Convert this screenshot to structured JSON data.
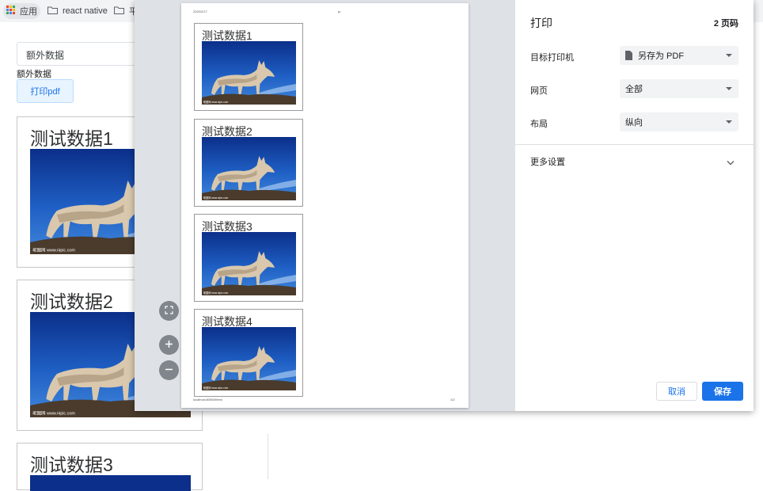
{
  "bookmarks": {
    "apps_label": "应用",
    "items": [
      "react native",
      "平"
    ]
  },
  "page": {
    "extra_input_value": "额外数据",
    "extra_label": "额外数据",
    "print_button": "打印pdf",
    "cards": [
      "测试数据1",
      "测试数据2",
      "测试数据3"
    ]
  },
  "preview": {
    "header_date": "2020/2/17",
    "header_title": "pr",
    "cards": [
      "测试数据1",
      "测试数据2",
      "测试数据3",
      "测试数据4"
    ],
    "footer_url": "localhost:8080/#/test",
    "footer_page": "1/2",
    "image_watermark": "昵图网 www.nipic.com"
  },
  "settings": {
    "title": "打印",
    "page_count": "2 页码",
    "destination_label": "目标打印机",
    "destination_value": "另存为 PDF",
    "pages_label": "网页",
    "pages_value": "全部",
    "layout_label": "布局",
    "layout_value": "纵向",
    "more_settings": "更多设置",
    "cancel": "取消",
    "save": "保存"
  },
  "colors": {
    "accent": "#1a73e8",
    "preview_bg": "#dee1e6"
  }
}
